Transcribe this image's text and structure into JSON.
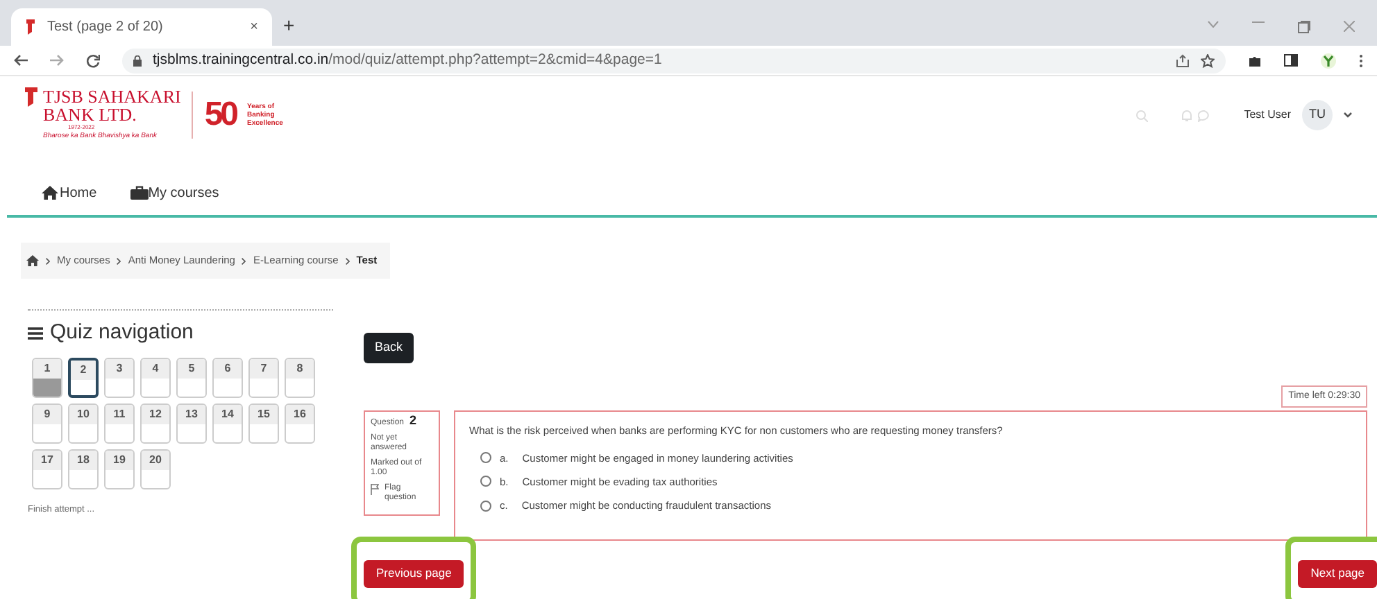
{
  "browser": {
    "tab_title": "Test (page 2 of 20)",
    "tab_close": "×",
    "new_tab": "+",
    "url_domain": "tjsblms.trainingcentral.co.in",
    "url_path": "/mod/quiz/attempt.php?attempt=2&cmid=4&page=1"
  },
  "header": {
    "logo": {
      "name_line1": "TJSB SAHAKARI",
      "name_line2": "BANK LTD.",
      "years": "1972-2022",
      "tagline": "Bharose ka Bank Bhavishya ka Bank",
      "anniversary_number": "50",
      "anniversary_text": [
        "Years of",
        "Banking",
        "Excellence"
      ]
    },
    "user_name": "Test User",
    "avatar_initials": "TU"
  },
  "nav": [
    {
      "label": "Home",
      "kind": "home"
    },
    {
      "label": "My courses",
      "kind": "briefcase"
    }
  ],
  "breadcrumb": [
    {
      "label": "My courses",
      "current": false
    },
    {
      "label": "Anti Money Laundering",
      "current": false
    },
    {
      "label": "E-Learning course",
      "current": false
    },
    {
      "label": "Test",
      "current": true
    }
  ],
  "quiz_navigation": {
    "title": "Quiz navigation",
    "questions": [
      {
        "number": "1",
        "answered": true,
        "selected": false
      },
      {
        "number": "2",
        "answered": false,
        "selected": true
      },
      {
        "number": "3",
        "answered": false,
        "selected": false
      },
      {
        "number": "4",
        "answered": false,
        "selected": false
      },
      {
        "number": "5",
        "answered": false,
        "selected": false
      },
      {
        "number": "6",
        "answered": false,
        "selected": false
      },
      {
        "number": "7",
        "answered": false,
        "selected": false
      },
      {
        "number": "8",
        "answered": false,
        "selected": false
      },
      {
        "number": "9",
        "answered": false,
        "selected": false
      },
      {
        "number": "10",
        "answered": false,
        "selected": false
      },
      {
        "number": "11",
        "answered": false,
        "selected": false
      },
      {
        "number": "12",
        "answered": false,
        "selected": false
      },
      {
        "number": "13",
        "answered": false,
        "selected": false
      },
      {
        "number": "14",
        "answered": false,
        "selected": false
      },
      {
        "number": "15",
        "answered": false,
        "selected": false
      },
      {
        "number": "16",
        "answered": false,
        "selected": false
      },
      {
        "number": "17",
        "answered": false,
        "selected": false
      },
      {
        "number": "18",
        "answered": false,
        "selected": false
      },
      {
        "number": "19",
        "answered": false,
        "selected": false
      },
      {
        "number": "20",
        "answered": false,
        "selected": false
      }
    ],
    "finish_link": "Finish attempt ..."
  },
  "back_button": "Back",
  "timer": "Time left 0:29:30",
  "question_info": {
    "label": "Question",
    "number": "2",
    "status": "Not yet answered",
    "marks": "Marked out of 1.00",
    "flag": "Flag question"
  },
  "question": {
    "text": "What is the risk perceived when banks are performing KYC for non customers who are requesting money transfers?",
    "options": [
      {
        "letter": "a.",
        "text": "Customer might be engaged in money laundering activities",
        "selected": false
      },
      {
        "letter": "b.",
        "text": "Customer might be evading tax authorities",
        "selected": false
      },
      {
        "letter": "c.",
        "text": "Customer might be conducting fraudulent transactions",
        "selected": false
      }
    ]
  },
  "buttons": [
    {
      "label": "Previous page",
      "highlighted": true
    },
    {
      "label": "Next page",
      "highlighted": true
    }
  ]
}
